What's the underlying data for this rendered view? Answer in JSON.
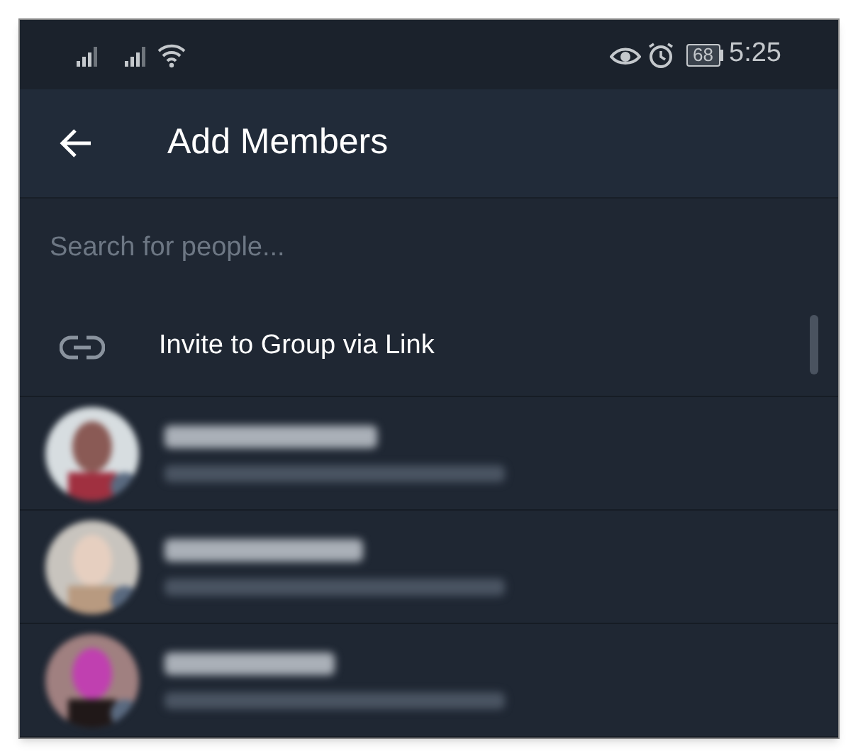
{
  "status_bar": {
    "battery": "68",
    "time": "5:25"
  },
  "header": {
    "title": "Add Members"
  },
  "search": {
    "placeholder": "Search for people..."
  },
  "invite": {
    "label": "Invite to Group via Link"
  },
  "contacts": [
    {
      "kind": "blurred"
    },
    {
      "kind": "blurred"
    },
    {
      "kind": "blurred"
    }
  ]
}
